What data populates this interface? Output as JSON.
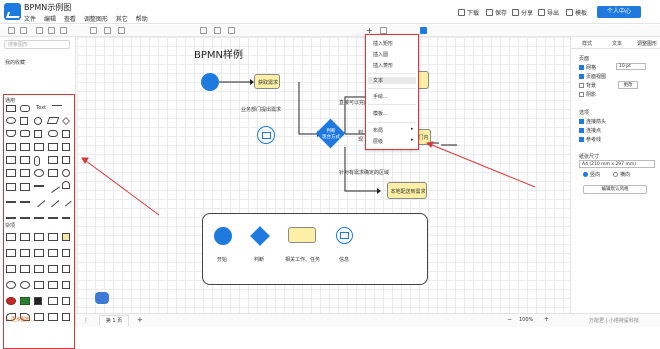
{
  "app": {
    "title": "BPMN示例图"
  },
  "menubar": {
    "items": [
      "文件",
      "编辑",
      "查看",
      "调整图形",
      "其它",
      "帮助"
    ]
  },
  "top_actions": {
    "download": "下载",
    "save": "保存",
    "share": "分享",
    "export": "导出",
    "template": "模板",
    "user_center": "个人中心"
  },
  "left_panel": {
    "search_placeholder": "搜索图形",
    "my_graphics": "我的收藏",
    "general": "通用",
    "misc": "杂项",
    "more": "+ 更多图形..."
  },
  "diagram": {
    "title": "BPMN样例",
    "task1": "获取需求",
    "message_label": "业务部门提出需求",
    "decision": "判断\n现合方式",
    "branch_top": "直接可以完成",
    "branch_bottom": "针对有需求确定的区域",
    "branch_mid_prefix": "判",
    "branch_mid_suffix": "现",
    "task_bottom": "本地配送到需求",
    "task_right_partial": "门内",
    "legend": {
      "start": "开始",
      "decision": "判断",
      "task": "相关工作、任务",
      "message": "信息"
    }
  },
  "context_menu": {
    "items": [
      "插入矩形",
      "插入圆",
      "插入菱形",
      "文本",
      "手绘...",
      "模板...",
      "布局",
      "层级"
    ]
  },
  "right_panel": {
    "tabs": [
      "样式",
      "文本",
      "调整图形"
    ],
    "page_view": "页面",
    "grid": "网格",
    "grid_size": "10 pt",
    "page_view_check": "页面视图",
    "background": "背景",
    "background_btn": "更改",
    "shadow": "阴影",
    "options": "选项",
    "connection_arrows": "连接箭头",
    "connection_points": "连接点",
    "guides": "参考线",
    "paper_size": "纸张尺寸",
    "paper_value": "A4 (210 mm x 297 mm)",
    "portrait": "竖向",
    "landscape": "横向",
    "default_btn": "编辑默认风格"
  },
  "statusbar": {
    "page_label": "第 1 页",
    "zoom": "100%"
  },
  "watermark": "万能君 | 小塔荷鲨科技",
  "colors": {
    "accent": "#1f7ae0",
    "annotation": "#d8383a",
    "task_fill": "#fdf0a6"
  }
}
